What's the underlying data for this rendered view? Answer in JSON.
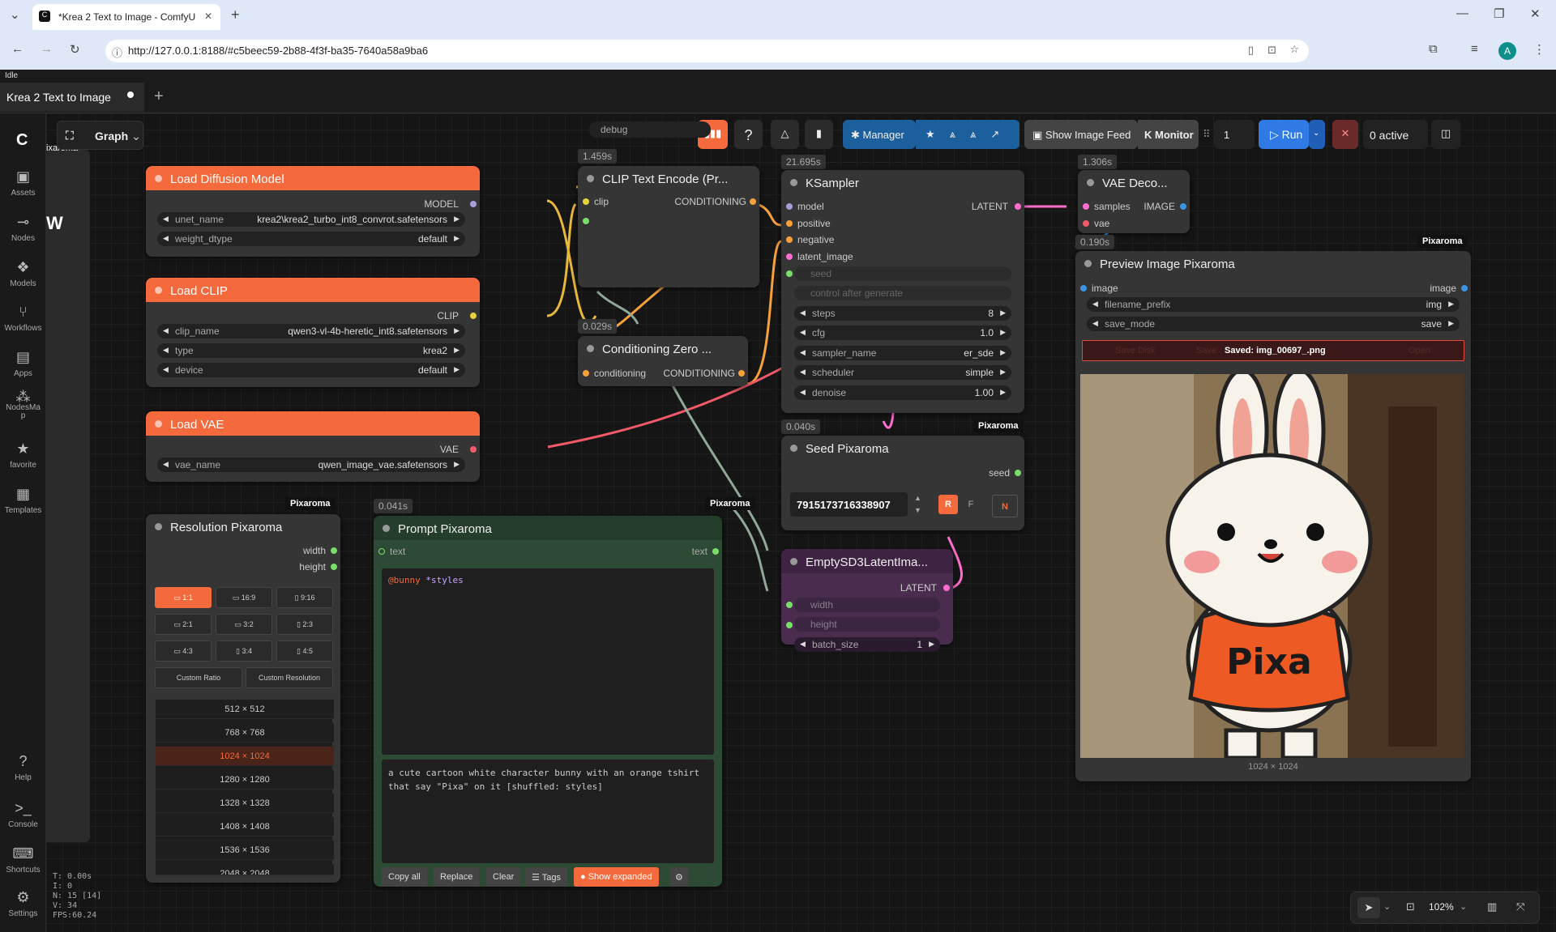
{
  "browser": {
    "tab_title": "*Krea 2 Text to Image - ComfyU",
    "url": "http://127.0.0.1:8188/#c5beec59-2b88-4f3f-ba35-7640a58a9ba6",
    "avatar_letter": "A"
  },
  "app": {
    "status": "Idle",
    "workflow_tab": "Krea 2 Text to Image",
    "graph_label": "Graph"
  },
  "toolbar": {
    "manager": "Manager",
    "show_image_feed": "Show Image Feed",
    "monitor": "K Monitor",
    "batch_count": "1",
    "run": "Run",
    "active": "0 active",
    "debug": "debug"
  },
  "sidebar": {
    "items": [
      "Assets",
      "Nodes",
      "Models",
      "Workflows",
      "Apps",
      "NodesMa\np",
      "favorite",
      "Templates"
    ],
    "bottom": [
      "Help",
      "Console",
      "Shortcuts",
      "Settings"
    ],
    "partial_label": "ixaroma",
    "partial_w": "W"
  },
  "stats": [
    "T: 0.00s",
    "I: 0",
    "N: 15 [14]",
    "V: 34",
    "FPS:60.24"
  ],
  "nodes": {
    "load_diffusion": {
      "title": "Load Diffusion Model",
      "out": "MODEL",
      "unet_label": "unet_name",
      "unet_value": "krea2\\krea2_turbo_int8_convrot.safetensors",
      "dtype_label": "weight_dtype",
      "dtype_value": "default"
    },
    "load_clip": {
      "title": "Load CLIP",
      "out": "CLIP",
      "clip_label": "clip_name",
      "clip_value": "qwen3-vl-4b-heretic_int8.safetensors",
      "type_label": "type",
      "type_value": "krea2",
      "device_label": "device",
      "device_value": "default"
    },
    "load_vae": {
      "title": "Load VAE",
      "out": "VAE",
      "vae_label": "vae_name",
      "vae_value": "qwen_image_vae.safetensors"
    },
    "clip_encode": {
      "time": "1.459s",
      "title": "CLIP Text Encode (Pr...",
      "in": "clip",
      "out": "CONDITIONING"
    },
    "cond_zero": {
      "time": "0.029s",
      "title": "Conditioning Zero ...",
      "in": "conditioning",
      "out": "CONDITIONING"
    },
    "ksampler": {
      "time": "21.695s",
      "title": "KSampler",
      "inputs": [
        "model",
        "positive",
        "negative",
        "latent_image"
      ],
      "out": "LATENT",
      "seed": "seed",
      "control": "control after generate",
      "steps_label": "steps",
      "steps": "8",
      "cfg_label": "cfg",
      "cfg": "1.0",
      "sampler_label": "sampler_name",
      "sampler": "er_sde",
      "scheduler_label": "scheduler",
      "scheduler": "simple",
      "denoise_label": "denoise",
      "denoise": "1.00"
    },
    "vae_decode": {
      "time": "1.306s",
      "title": "VAE Deco...",
      "in1": "samples",
      "in2": "vae",
      "out": "IMAGE"
    },
    "preview": {
      "time": "0.190s",
      "badge": "Pixaroma",
      "title": "Preview Image Pixaroma",
      "in": "image",
      "out": "image",
      "prefix_label": "filename_prefix",
      "prefix_value": "img",
      "mode_label": "save_mode",
      "mode_value": "save",
      "save_disk": "Save Disk",
      "save": "Save",
      "saved": "Saved: img_00697_.png",
      "open": "Open",
      "size": "1024 × 1024",
      "shirt_text": "Pixa"
    },
    "seed": {
      "time": "0.040s",
      "badge": "Pixaroma",
      "title": "Seed Pixaroma",
      "out": "seed",
      "value": "7915173716338907",
      "r": "R",
      "f": "F",
      "n": "N"
    },
    "resolution": {
      "badge": "Pixaroma",
      "title": "Resolution Pixaroma",
      "out1": "width",
      "out2": "height",
      "ratios": [
        "1:1",
        "16:9",
        "9:16",
        "2:1",
        "3:2",
        "2:3",
        "4:3",
        "3:4",
        "4:5"
      ],
      "custom_ratio": "Custom Ratio",
      "custom_res": "Custom Resolution",
      "sizes": [
        "512 × 512",
        "768 × 768",
        "1024 × 1024",
        "1280 × 1280",
        "1328 × 1328",
        "1408 × 1408",
        "1536 × 1536",
        "2048 × 2048"
      ]
    },
    "prompt": {
      "time": "0.041s",
      "badge": "Pixaroma",
      "title": "Prompt Pixaroma",
      "in": "text",
      "out": "text",
      "template_a": "@bunny",
      "template_b": "*styles",
      "text": "a cute cartoon white character bunny with an orange tshirt that say \"Pixa\" on it [shuffled: styles]",
      "copy": "Copy all",
      "replace": "Replace",
      "clear": "Clear",
      "tags": "☰ Tags",
      "show_expanded": "Show expanded"
    },
    "latent": {
      "title": "EmptySD3LatentIma...",
      "out": "LATENT",
      "width": "width",
      "height": "height",
      "batch_label": "batch_size",
      "batch": "1"
    }
  },
  "zoom": "102%",
  "colors": {
    "accent": "#f46a3c",
    "run": "#2f7ae5",
    "manager": "#1b5f9c"
  }
}
